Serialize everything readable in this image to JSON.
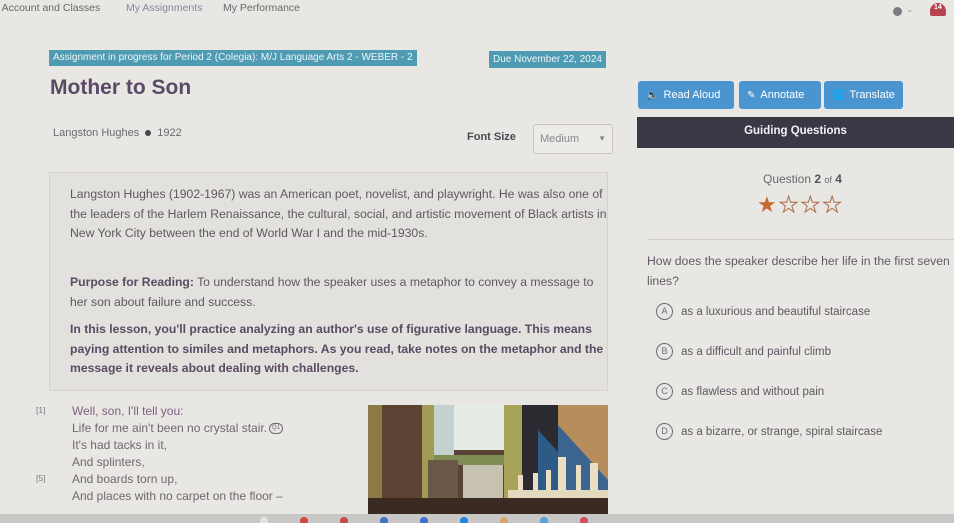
{
  "topnav": {
    "items": [
      {
        "label": "y Account and Classes"
      },
      {
        "label": "My Assignments"
      },
      {
        "label": "My Performance"
      }
    ],
    "notification_count": "14"
  },
  "banner": {
    "assignment": "Assignment in progress for Period 2 (Colegia): M/J Language Arts 2 - WEBER - 2",
    "due": "Due November 22, 2024"
  },
  "title": "Mother to Son",
  "meta": {
    "author": "Langston Hughes",
    "year": "1922"
  },
  "toolbar": {
    "read_aloud": "Read Aloud",
    "annotate": "Annotate",
    "translate": "Translate"
  },
  "font_size": {
    "label": "Font Size",
    "value": "Medium"
  },
  "guiding_questions": {
    "header": "Guiding Questions",
    "question_label": "Question",
    "current": "2",
    "of_label": "of",
    "total": "4",
    "stars_filled": 1,
    "stars_total": 4,
    "prompt": "How does the speaker describe her life in the first seven lines?",
    "options": [
      {
        "letter": "A",
        "text": "as a luxurious and beautiful staircase"
      },
      {
        "letter": "B",
        "text": "as a difficult and painful climb"
      },
      {
        "letter": "C",
        "text": "as flawless and without pain"
      },
      {
        "letter": "D",
        "text": "as a bizarre, or strange, spiral staircase"
      }
    ]
  },
  "intro": {
    "bio": "Langston Hughes (1902-1967) was an American poet, novelist, and playwright. He was also one of the leaders of the Harlem Renaissance, the cultural, social, and artistic movement of Black artists in New York City between the end of World War I and the mid-1930s.",
    "purpose_label": "Purpose for Reading:",
    "purpose_text": " To understand how the speaker uses a metaphor to convey a message to her son about failure and success.",
    "lesson": "In this lesson, you'll practice analyzing an author's use of figurative language. This means paying attention to similes and metaphors. As you read, take notes on the metaphor and the message it reveals about dealing with challenges."
  },
  "poem": {
    "lines": [
      {
        "num": "[1]",
        "text": "Well, son, I'll tell you:"
      },
      {
        "num": "",
        "text": "Life for me ain't been no crystal stair.",
        "annotation": "Q1"
      },
      {
        "num": "",
        "text": "It's had tacks in it,"
      },
      {
        "num": "",
        "text": "And splinters,"
      },
      {
        "num": "[5]",
        "text": "And boards torn up,"
      },
      {
        "num": "",
        "text": "And places with no carpet on the floor –"
      }
    ]
  }
}
